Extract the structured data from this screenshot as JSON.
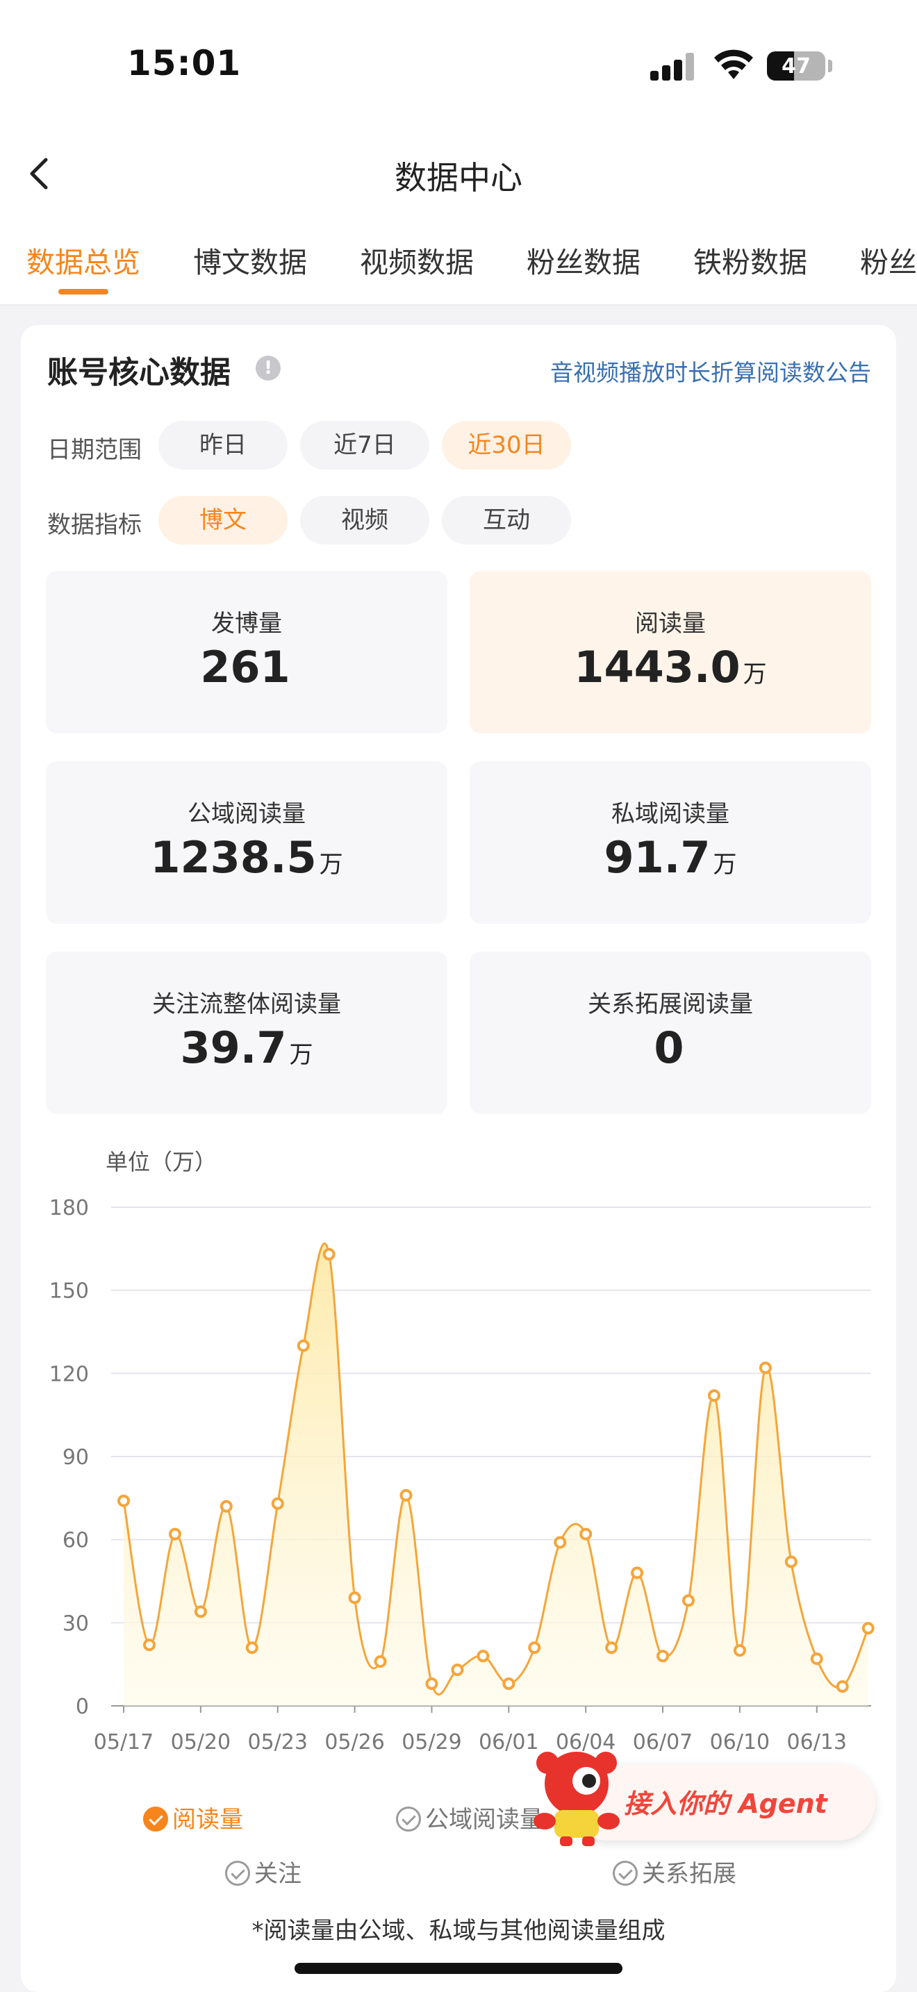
{
  "status": {
    "time": "15:01",
    "battery": "47",
    "battery_level": 0.47
  },
  "nav": {
    "title": "数据中心"
  },
  "tabs": [
    "数据总览",
    "博文数据",
    "视频数据",
    "粉丝数据",
    "铁粉数据",
    "粉丝"
  ],
  "card": {
    "title": "账号核心数据",
    "info_icon": "!",
    "notice_link": "音视频播放时长折算阅读数公告",
    "date_range": {
      "label": "日期范围",
      "options": [
        "昨日",
        "近7日",
        "近30日"
      ],
      "selected": "近30日"
    },
    "metric": {
      "label": "数据指标",
      "options": [
        "博文",
        "视频",
        "互动"
      ],
      "selected": "博文"
    }
  },
  "stats": [
    {
      "label": "发博量",
      "value": "261",
      "unit": ""
    },
    {
      "label": "阅读量",
      "value": "1443.0",
      "unit": "万"
    },
    {
      "label": "公域阅读量",
      "value": "1238.5",
      "unit": "万"
    },
    {
      "label": "私域阅读量",
      "value": "91.7",
      "unit": "万"
    },
    {
      "label": "关注流整体阅读量",
      "value": "39.7",
      "unit": "万"
    },
    {
      "label": "关系拓展阅读量",
      "value": "0",
      "unit": ""
    }
  ],
  "chart_data": {
    "type": "area",
    "ylabel": "单位（万）",
    "ylim": [
      0,
      180
    ],
    "yticks": [
      0,
      30,
      60,
      90,
      120,
      150,
      180
    ],
    "grid": true,
    "x_tick_labels": [
      "05/17",
      "05/20",
      "05/23",
      "05/26",
      "05/29",
      "06/01",
      "06/04",
      "06/07",
      "06/10",
      "06/13"
    ],
    "x": [
      "05/17",
      "05/18",
      "05/19",
      "05/20",
      "05/21",
      "05/22",
      "05/23",
      "05/24",
      "05/25",
      "05/26",
      "05/27",
      "05/28",
      "05/29",
      "05/30",
      "05/31",
      "06/01",
      "06/02",
      "06/03",
      "06/04",
      "06/05",
      "06/06",
      "06/07",
      "06/08",
      "06/09",
      "06/10",
      "06/11",
      "06/12",
      "06/13",
      "06/14",
      "06/15"
    ],
    "series": [
      {
        "name": "阅读量",
        "values": [
          74,
          22,
          62,
          34,
          72,
          21,
          73,
          130,
          163,
          39,
          16,
          76,
          8,
          13,
          18,
          8,
          21,
          59,
          62,
          21,
          48,
          18,
          38,
          112,
          20,
          122,
          52,
          17,
          7,
          28
        ]
      }
    ],
    "color": "#f5a53a"
  },
  "legend": {
    "items": [
      {
        "label": "阅读量",
        "checked": true
      },
      {
        "label": "公域阅读量",
        "checked": false
      },
      {
        "label": "关注",
        "checked": false
      },
      {
        "label": "关系拓展",
        "checked": false
      }
    ]
  },
  "footnote": "*阅读量由公域、私域与其他阅读量组成",
  "agent": {
    "text": "接入你的 Agent"
  }
}
